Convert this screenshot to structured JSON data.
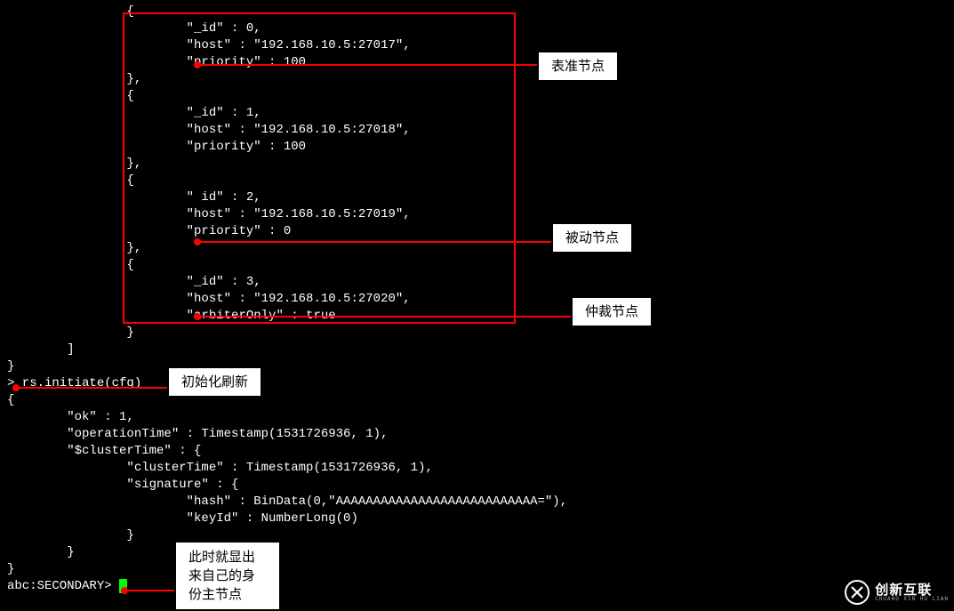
{
  "code": {
    "l1": "                {",
    "l2": "                        \"_id\" : 0,",
    "l3": "                        \"host\" : \"192.168.10.5:27017\",",
    "l4": "                        \"priority\" : 100",
    "l5": "                },",
    "l6": "                {",
    "l7": "                        \"_id\" : 1,",
    "l8": "                        \"host\" : \"192.168.10.5:27018\",",
    "l9": "                        \"priority\" : 100",
    "l10": "                },",
    "l11": "                {",
    "l12": "                        \" id\" : 2,",
    "l13": "                        \"host\" : \"192.168.10.5:27019\",",
    "l14": "                        \"priority\" : 0",
    "l15": "                },",
    "l16": "                {",
    "l17": "                        \"_id\" : 3,",
    "l18": "                        \"host\" : \"192.168.10.5:27020\",",
    "l19": "                        \"arbiterOnly\" : true",
    "l20": "                }",
    "l21": "        ]",
    "l22": "}",
    "l23": "> rs.initiate(cfg)",
    "l24": "{",
    "l25": "        \"ok\" : 1,",
    "l26": "        \"operationTime\" : Timestamp(1531726936, 1),",
    "l27": "        \"$clusterTime\" : {",
    "l28": "                \"clusterTime\" : Timestamp(1531726936, 1),",
    "l29": "                \"signature\" : {",
    "l30": "                        \"hash\" : BinData(0,\"AAAAAAAAAAAAAAAAAAAAAAAAAAA=\"),",
    "l31": "                        \"keyId\" : NumberLong(0)",
    "l32": "                }",
    "l33": "        }",
    "l34": "}",
    "l35": "abc:SECONDARY> "
  },
  "annotations": {
    "standard_node": "表准节点",
    "passive_node": "被动节点",
    "arbiter_node": "仲裁节点",
    "init_refresh": "初始化刷新",
    "identity_note": "此时就显出来自己的身份主节点"
  },
  "logo": {
    "main": "创新互联",
    "sub": "CHUANG XIN HU LIAN",
    "icon": "X"
  },
  "colors": {
    "accent_red": "#ff0000",
    "cursor_green": "#00ff00"
  }
}
